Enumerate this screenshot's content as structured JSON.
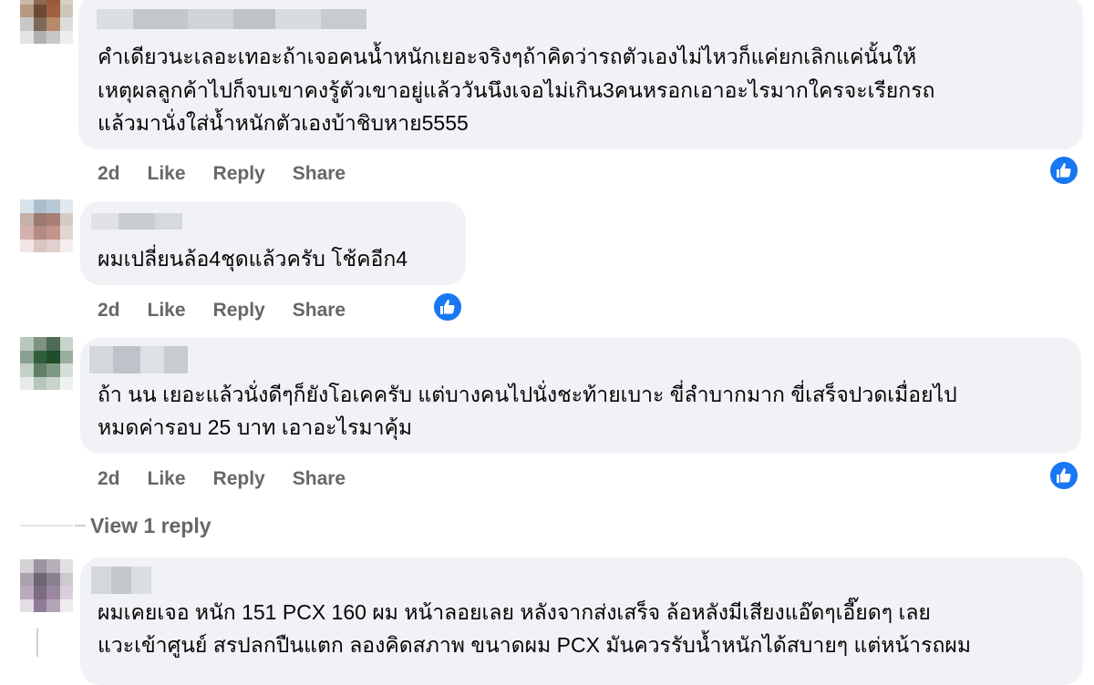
{
  "comments": [
    {
      "lines": [
        "คำเดียวนะเลอะเทอะถ้าเจอคนน้ำหนักเยอะจริงๆถ้าคิดว่ารถตัวเองไม่ไหวก็แค่ยกเลิกแค่นั้นให้",
        "เหตุผลลูกค้าไปก็จบเขาคงรู้ตัวเขาอยู่แล้ววันนึงเจอไม่เกิน3คนหรอกเอาอะไรมากใครจะเรียกรถ",
        "แล้วมานั่งใส่น้ำหนักตัวเองบ้าชิบหาย5555"
      ],
      "time": "2d",
      "like": "Like",
      "reply": "Reply",
      "share": "Share"
    },
    {
      "lines": [
        "ผมเปลี่ยนล้อ4ชุดแล้วครับ โช้คอีก4"
      ],
      "time": "2d",
      "like": "Like",
      "reply": "Reply",
      "share": "Share"
    },
    {
      "lines": [
        "ถ้า นน เยอะแล้วนั่งดีๆก็ยังโอเคครับ แต่บางคนไปนั่งชะท้ายเบาะ ขี่ลำบากมาก ขี่เสร็จปวดเมื่อยไป",
        "หมดค่ารอบ 25 บาท เอาอะไรมาคุ้ม"
      ],
      "time": "2d",
      "like": "Like",
      "reply": "Reply",
      "share": "Share"
    },
    {
      "lines": [
        "ผมเคยเจอ หนัก 151 PCX 160 ผม หน้าลอยเลย หลังจากส่งเสร็จ ล้อหลังมีเสียงแอ๊ดๆเอี๊ยดๆ เลย",
        "แวะเข้าศูนย์ สรปลกปืนแตก ลองคิดสภาพ ขนาดผม PCX มันควรรับน้ำหนักได้สบายๆ แต่หน้ารถผม"
      ]
    }
  ],
  "view_replies": "View 1 reply",
  "colors": {
    "bubble": "#f0f2f5",
    "meta": "#65676b",
    "like": "#1877f2"
  }
}
